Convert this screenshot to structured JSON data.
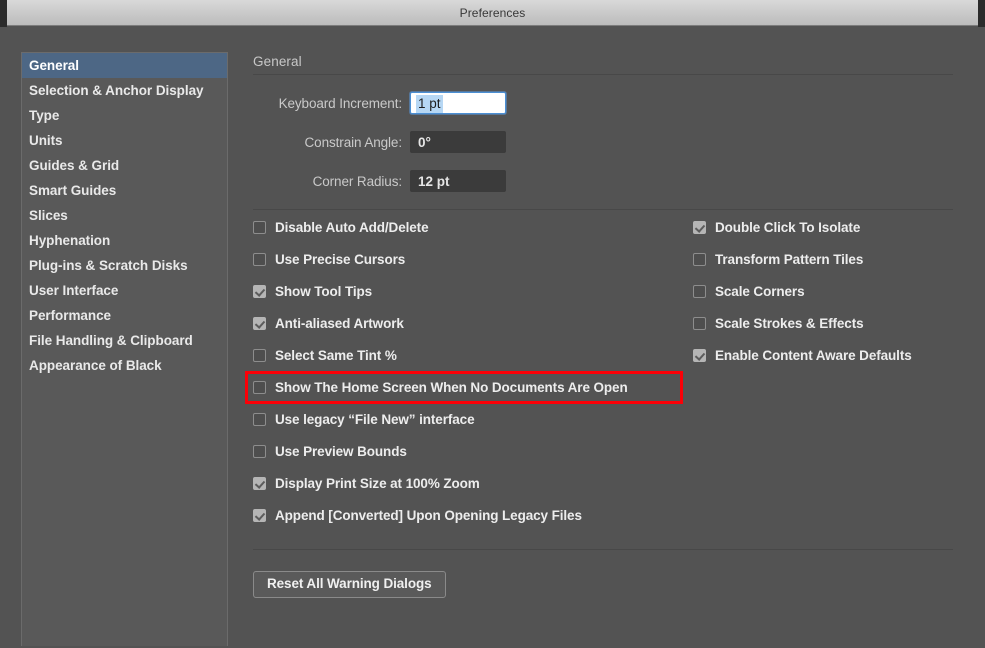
{
  "window": {
    "title": "Preferences"
  },
  "sidebar": {
    "items": [
      {
        "label": "General",
        "selected": true
      },
      {
        "label": "Selection & Anchor Display",
        "selected": false
      },
      {
        "label": "Type",
        "selected": false
      },
      {
        "label": "Units",
        "selected": false
      },
      {
        "label": "Guides & Grid",
        "selected": false
      },
      {
        "label": "Smart Guides",
        "selected": false
      },
      {
        "label": "Slices",
        "selected": false
      },
      {
        "label": "Hyphenation",
        "selected": false
      },
      {
        "label": "Plug-ins & Scratch Disks",
        "selected": false
      },
      {
        "label": "User Interface",
        "selected": false
      },
      {
        "label": "Performance",
        "selected": false
      },
      {
        "label": "File Handling & Clipboard",
        "selected": false
      },
      {
        "label": "Appearance of Black",
        "selected": false
      }
    ]
  },
  "panel": {
    "title": "General",
    "fields": [
      {
        "label": "Keyboard Increment:",
        "value": "1 pt",
        "focused": true
      },
      {
        "label": "Constrain Angle:",
        "value": "0°",
        "focused": false
      },
      {
        "label": "Corner Radius:",
        "value": "12 pt",
        "focused": false
      }
    ],
    "checkboxes_left": [
      {
        "label": "Disable Auto Add/Delete",
        "checked": false,
        "highlighted": false
      },
      {
        "label": "Use Precise Cursors",
        "checked": false,
        "highlighted": false
      },
      {
        "label": "Show Tool Tips",
        "checked": true,
        "highlighted": false
      },
      {
        "label": "Anti-aliased Artwork",
        "checked": true,
        "highlighted": false
      },
      {
        "label": "Select Same Tint %",
        "checked": false,
        "highlighted": false
      },
      {
        "label": "Show The Home Screen When No Documents Are Open",
        "checked": false,
        "highlighted": true
      },
      {
        "label": "Use legacy “File New” interface",
        "checked": false,
        "highlighted": false
      },
      {
        "label": "Use Preview Bounds",
        "checked": false,
        "highlighted": false
      },
      {
        "label": "Display Print Size at 100% Zoom",
        "checked": true,
        "highlighted": false
      },
      {
        "label": "Append [Converted] Upon Opening Legacy Files",
        "checked": true,
        "highlighted": false
      }
    ],
    "checkboxes_right": [
      {
        "label": "Double Click To Isolate",
        "checked": true
      },
      {
        "label": "Transform Pattern Tiles",
        "checked": false
      },
      {
        "label": "Scale Corners",
        "checked": false
      },
      {
        "label": "Scale Strokes & Effects",
        "checked": false
      },
      {
        "label": "Enable Content Aware Defaults",
        "checked": true
      }
    ],
    "reset_button": "Reset All Warning Dialogs"
  },
  "colors": {
    "window_bg": "#535353",
    "sidebar_bg": "#595959",
    "selection": "#4d6785",
    "highlight_red": "#fb0007",
    "focus_blue": "#4b8fd4",
    "text_selection_blue": "#b6d7f4"
  }
}
